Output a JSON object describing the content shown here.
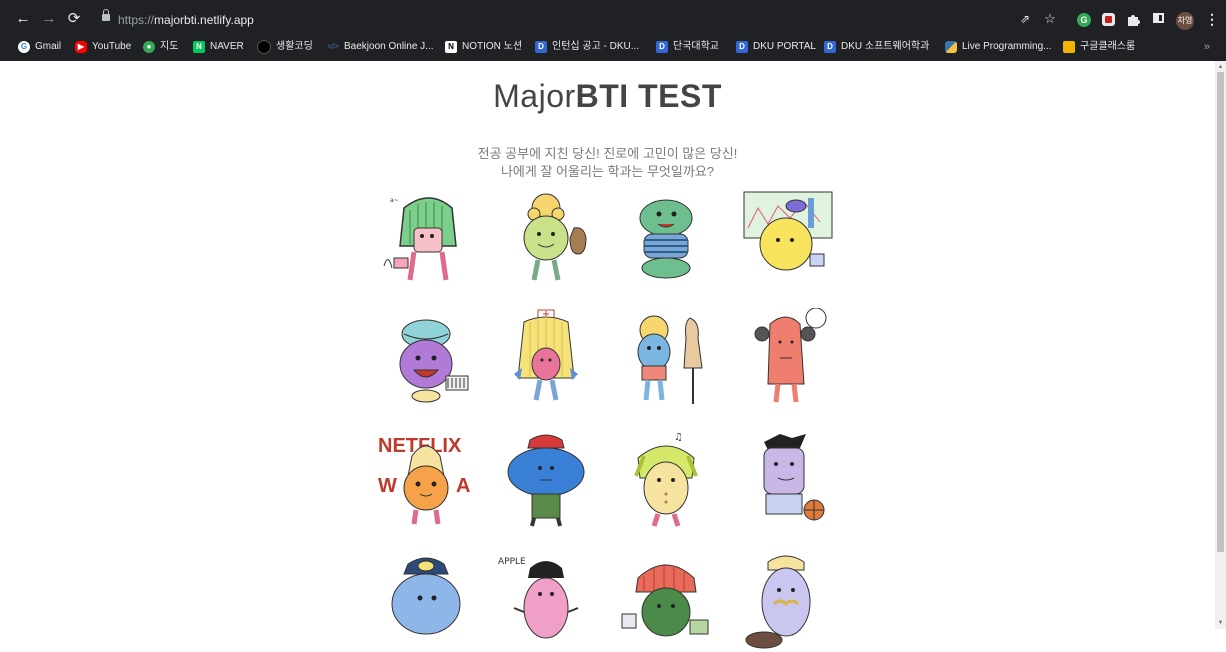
{
  "browser": {
    "url_scheme": "https://",
    "url_host": "majorbti.netlify.app",
    "profile_label": "차영",
    "bookmarks": [
      {
        "label": "Gmail",
        "icon": "google-icon",
        "color": "#ea4335"
      },
      {
        "label": "YouTube",
        "icon": "youtube-icon",
        "color": "#ff0000"
      },
      {
        "label": "지도",
        "icon": "maps-icon",
        "color": "#34a853"
      },
      {
        "label": "NAVER",
        "icon": "naver-icon",
        "color": "#03c75a"
      },
      {
        "label": "생활코딩",
        "icon": "circle-icon",
        "color": "#000000"
      },
      {
        "label": "Baekjoon Online J...",
        "icon": "code-icon",
        "color": "#3b5998"
      },
      {
        "label": "NOTION 노션",
        "icon": "notion-icon",
        "color": "#ffffff"
      },
      {
        "label": "인턴십 공고 - DKU...",
        "icon": "dku-icon",
        "color": "#3367d6"
      },
      {
        "label": "단국대학교",
        "icon": "dku-icon",
        "color": "#3367d6"
      },
      {
        "label": "DKU PORTAL",
        "icon": "dku-icon",
        "color": "#3367d6"
      },
      {
        "label": "DKU 소프트웨어학과",
        "icon": "dku-icon",
        "color": "#3367d6"
      },
      {
        "label": "Live Programming...",
        "icon": "python-icon",
        "color": "#f7c33c"
      },
      {
        "label": "구글클래스룸",
        "icon": "classroom-icon",
        "color": "#f4b400"
      }
    ]
  },
  "page": {
    "title_light": "Major",
    "title_bold": "BTI TEST",
    "subtitle_line1": "전공 공부에 지친 당신! 진로에 고민이 많은 당신!",
    "subtitle_line2": "나에게 잘 어울리는 학과는 무엇일까요?"
  },
  "characters": [
    {
      "name": "green-hair-character-icon",
      "text": ""
    },
    {
      "name": "curly-blonde-pot-character-icon",
      "text": ""
    },
    {
      "name": "green-blob-character-icon",
      "text": ""
    },
    {
      "name": "yellow-chart-character-icon",
      "text": ""
    },
    {
      "name": "purple-turban-character-icon",
      "text": ""
    },
    {
      "name": "nurse-character-icon",
      "text": ""
    },
    {
      "name": "fashion-character-icon",
      "text": ""
    },
    {
      "name": "red-bun-character-icon",
      "text": ""
    },
    {
      "name": "netflix-character-icon",
      "text": "NETFLIX"
    },
    {
      "name": "blue-cap-character-icon",
      "text": ""
    },
    {
      "name": "music-character-icon",
      "text": ""
    },
    {
      "name": "basketball-character-icon",
      "text": ""
    },
    {
      "name": "cap-blue-character-icon",
      "text": ""
    },
    {
      "name": "apple-character-icon",
      "text": "APPLE"
    },
    {
      "name": "green-red-hair-character-icon",
      "text": ""
    },
    {
      "name": "mustache-character-icon",
      "text": ""
    }
  ]
}
